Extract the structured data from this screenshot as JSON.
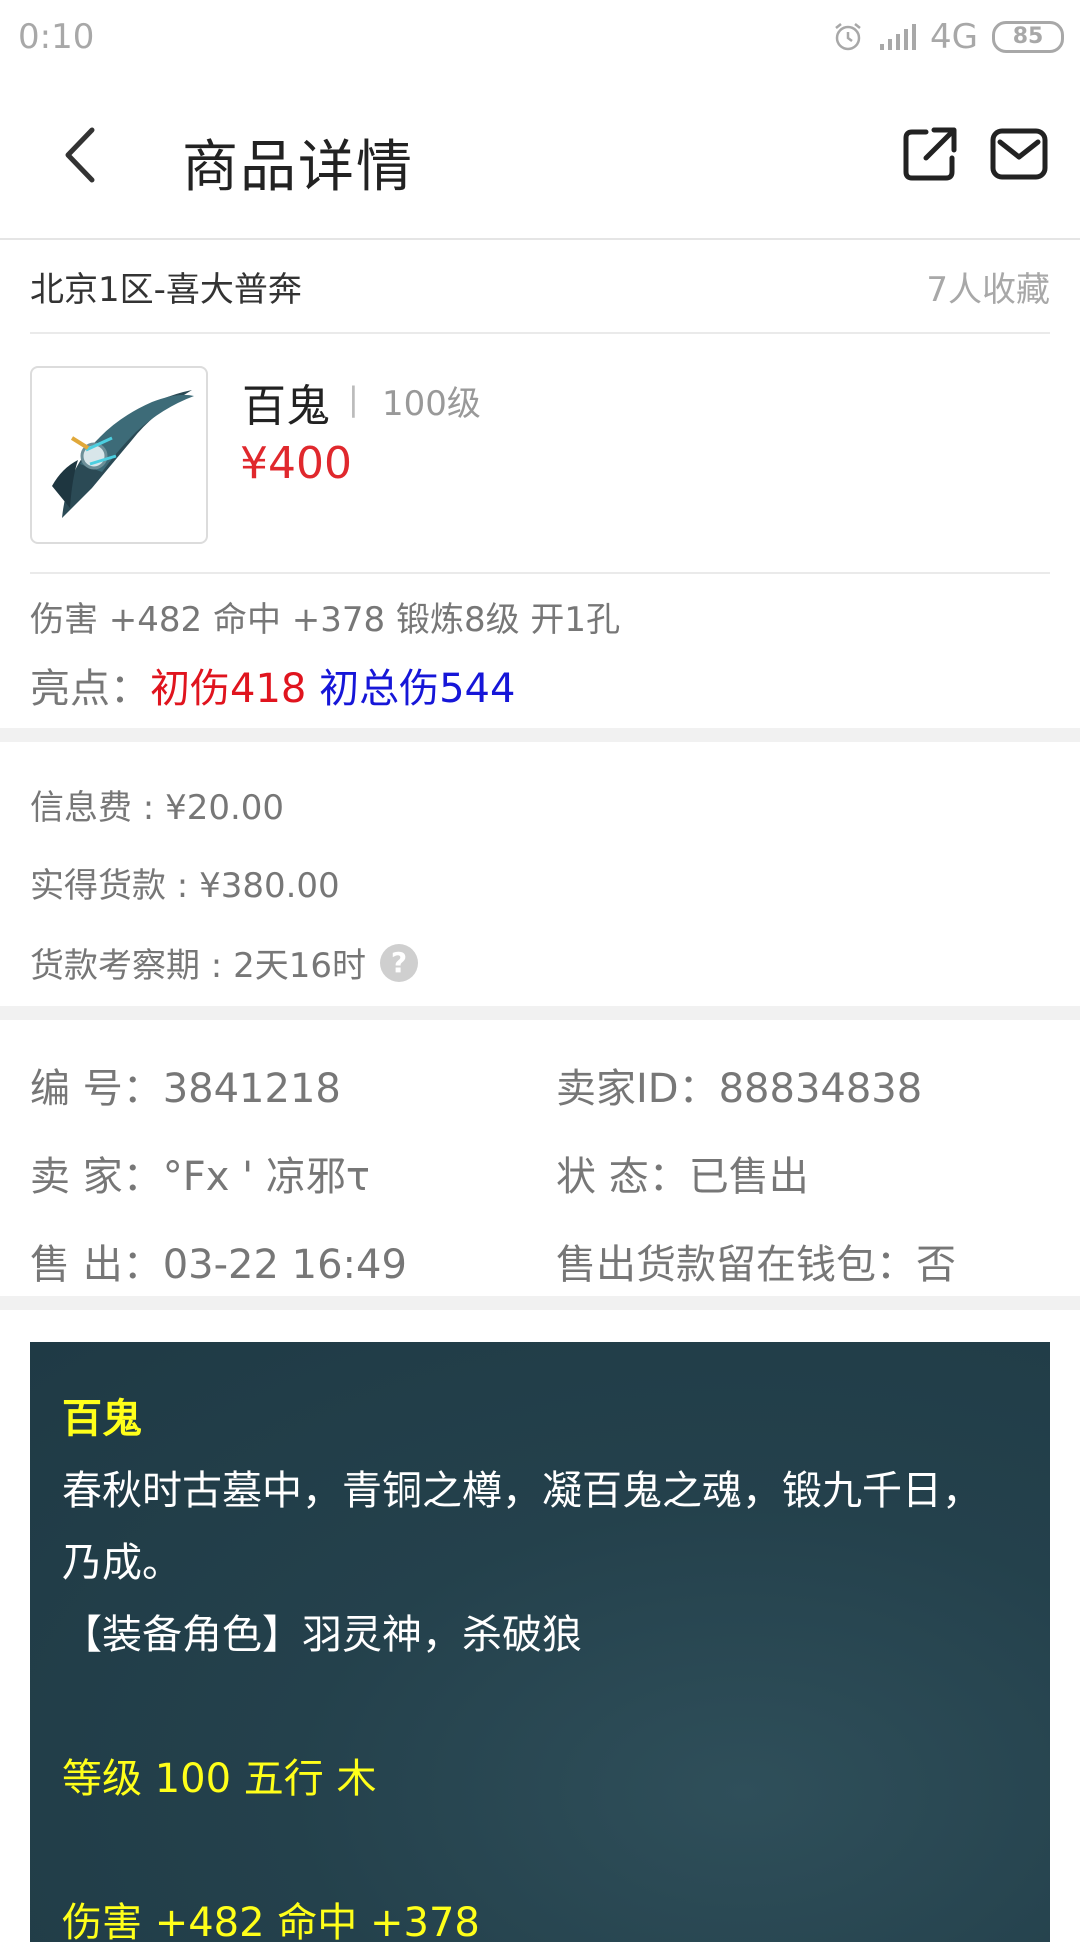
{
  "status_bar": {
    "time": "0:10",
    "network": "4G",
    "battery": "85"
  },
  "header": {
    "title": "商品详情"
  },
  "listing": {
    "server": "北京1区-喜大普奔",
    "favorites": "7人收藏"
  },
  "item": {
    "name": "百鬼",
    "separator": "|",
    "level": "100级",
    "price": "¥400",
    "stats": "伤害 +482 命中 +378 锻炼8级 开1孔",
    "highlight_label": "亮点：",
    "highlight_red": "初伤418",
    "highlight_blue": "初总伤544"
  },
  "fees": {
    "info_fee": "信息费 : ¥20.00",
    "actual_payment": "实得货款 : ¥380.00",
    "review_period": "货款考察期 : 2天16时",
    "help_icon": "?"
  },
  "details": {
    "number": "编  号：3841218",
    "seller_id": "卖家ID：88834838",
    "seller": "卖  家：°Fx ' 凉邪τ",
    "status": "状  态：已售出",
    "sold": "售  出：03-22 16:49",
    "keep_in_wallet": "售出货款留在钱包：否"
  },
  "description": {
    "title": "百鬼",
    "line1": "春秋时古墓中，青铜之樽，凝百鬼之魂，锻九千日，",
    "line2": "乃成。",
    "line3": "【装备角色】羽灵神，杀破狼",
    "line4": "等级 100 五行 木",
    "line5": "伤害 +482 命中 +378"
  },
  "colors": {
    "price_red": "#e0282d",
    "highlight_red": "#e0141e",
    "highlight_blue": "#1616d8",
    "card_bg": "#24414c",
    "card_yellow": "#ffff1a"
  }
}
